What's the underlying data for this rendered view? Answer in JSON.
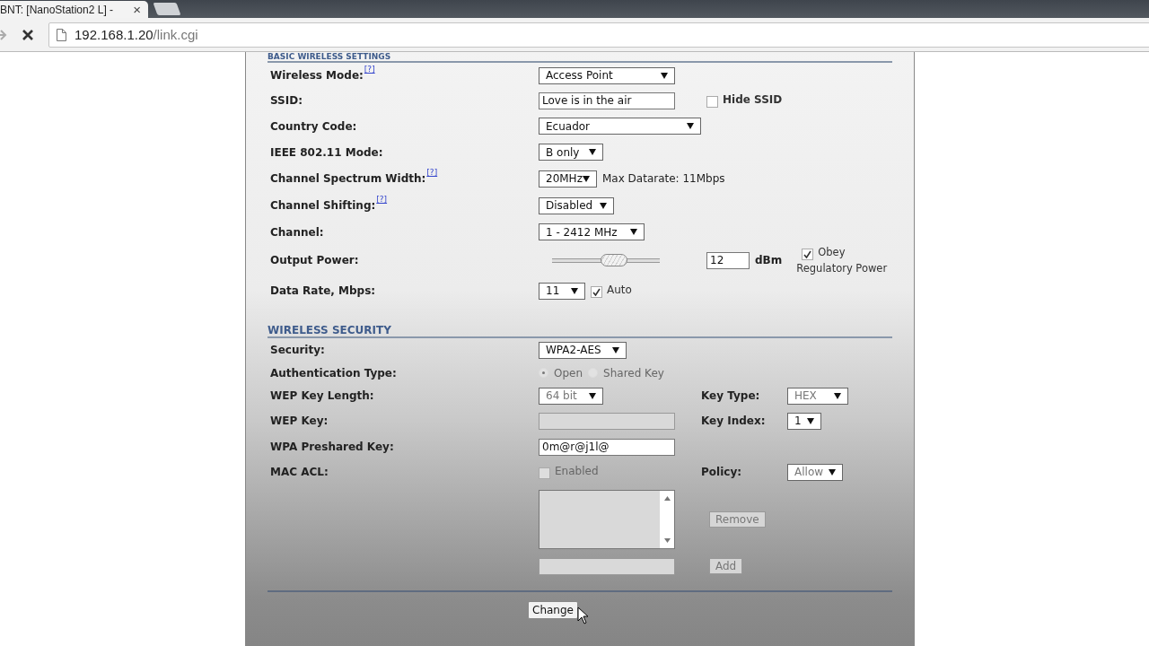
{
  "browser": {
    "tab_title": "BNT: [NanoStation2 L] -",
    "tab_close": "×",
    "address_host": "192.168.1.20",
    "address_path": "/link.cgi"
  },
  "basic": {
    "title": "BASIC WIRELESS SETTINGS",
    "rows": [
      {
        "label": "Wireless Mode:",
        "help": "[?]",
        "controls": [
          {
            "kind": "select",
            "value": "Access Point"
          }
        ]
      },
      {
        "label": "SSID:",
        "controls": [
          {
            "kind": "text",
            "value": "Love is in the air"
          }
        ],
        "side": {
          "controls": [
            {
              "kind": "checkbox",
              "label": "Hide SSID",
              "checked": false
            }
          ]
        }
      },
      {
        "label": "Country Code:",
        "controls": [
          {
            "kind": "select",
            "value": "Ecuador"
          }
        ]
      },
      {
        "label": "IEEE 802.11 Mode:",
        "controls": [
          {
            "kind": "select",
            "value": "B only"
          }
        ]
      },
      {
        "label": "Channel Spectrum Width:",
        "help": "[?]",
        "controls": [
          {
            "kind": "select",
            "value": "20MHz"
          },
          {
            "kind": "note",
            "text": "Max Datarate: 11Mbps"
          }
        ]
      },
      {
        "label": "Channel Shifting:",
        "help": "[?]",
        "controls": [
          {
            "kind": "select",
            "value": "Disabled"
          }
        ]
      },
      {
        "label": "Channel:",
        "controls": [
          {
            "kind": "select",
            "value": "1 - 2412 MHz"
          }
        ]
      },
      {
        "label": "Output Power:",
        "controls": [
          {
            "kind": "slider",
            "level": 0.6
          }
        ],
        "side": {
          "controls": [
            {
              "kind": "text",
              "value": "12"
            },
            {
              "kind": "unit",
              "text": "dBm"
            },
            {
              "kind": "checkbox",
              "label": "Obey",
              "sublabel": "Regulatory Power",
              "checked": true
            }
          ]
        }
      },
      {
        "label": "Data Rate, Mbps:",
        "controls": [
          {
            "kind": "select",
            "value": "11"
          },
          {
            "kind": "checkbox",
            "label": "Auto",
            "checked": true
          }
        ]
      }
    ]
  },
  "security": {
    "title": "WIRELESS SECURITY",
    "rows": [
      {
        "label": "Security:",
        "controls": [
          {
            "kind": "select",
            "value": "WPA2-AES",
            "disabled": false
          }
        ]
      },
      {
        "label": "Authentication Type:",
        "controls": [
          {
            "kind": "radio",
            "disabled": true,
            "options": [
              {
                "label": "Open",
                "selected": true
              },
              {
                "label": "Shared Key",
                "selected": false
              }
            ]
          }
        ]
      },
      {
        "label": "WEP Key Length:",
        "controls": [
          {
            "kind": "select",
            "value": "64 bit",
            "disabled": true
          }
        ],
        "side": {
          "label": "Key Type:",
          "controls": [
            {
              "kind": "select",
              "value": "HEX",
              "disabled": true
            }
          ]
        }
      },
      {
        "label": "WEP Key:",
        "controls": [
          {
            "kind": "text",
            "disabled": true
          }
        ],
        "side": {
          "label": "Key Index:",
          "controls": [
            {
              "kind": "select",
              "value": "1",
              "disabled": false
            }
          ]
        }
      },
      {
        "label": "WPA Preshared Key:",
        "controls": [
          {
            "kind": "text",
            "value": "0m@r@j1l@",
            "disabled": false
          }
        ]
      },
      {
        "label": "MAC ACL:",
        "controls": [
          {
            "kind": "checkbox",
            "label": "Enabled",
            "checked": false,
            "disabled": true
          }
        ],
        "side": {
          "label": "Policy:",
          "controls": [
            {
              "kind": "select",
              "value": "Allow",
              "disabled": true
            }
          ]
        }
      },
      {
        "controls": [
          {
            "kind": "listbox",
            "disabled": true
          }
        ],
        "side": {
          "controls": [
            {
              "kind": "button",
              "label": "Remove",
              "disabled": true
            }
          ]
        }
      },
      {
        "controls": [
          {
            "kind": "text",
            "disabled": true
          }
        ],
        "side": {
          "controls": [
            {
              "kind": "button",
              "label": "Add",
              "disabled": true
            }
          ]
        }
      }
    ]
  },
  "change_button": "Change"
}
